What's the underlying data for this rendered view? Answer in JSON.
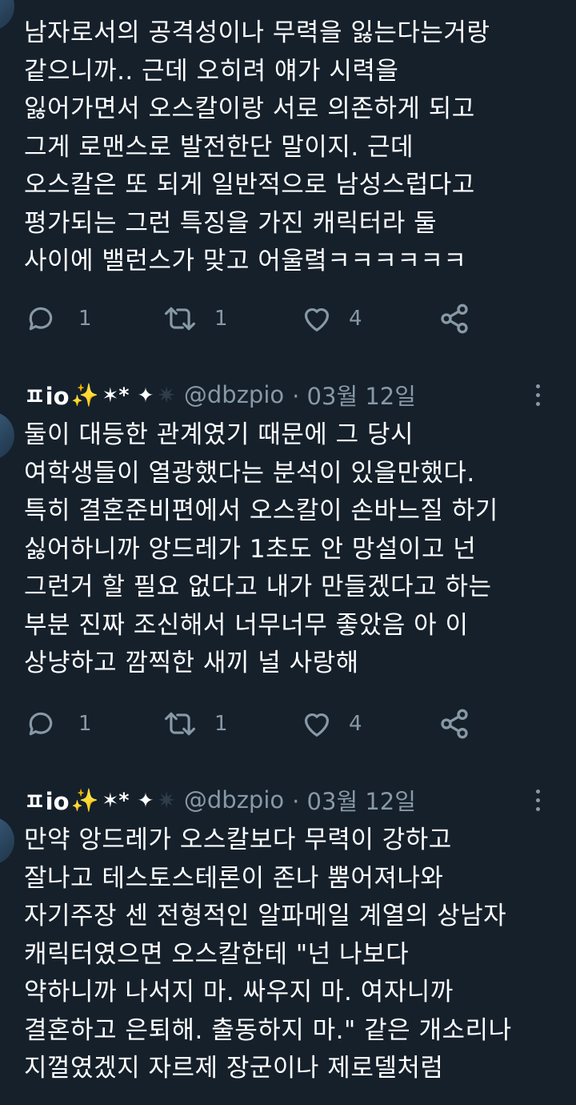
{
  "tweets": [
    {
      "lines": [
        "남자로서의 공격성이나 무력을 잃는다는거랑",
        "같으니까.. 근데 오히려 얘가 시력을",
        "잃어가면서 오스칼이랑 서로 의존하게 되고",
        "그게 로맨스로 발전한단 말이지. 근데",
        "오스칼은 또 되게 일반적으로 남성스럽다고",
        "평가되는 그런 특징을 가진 캐릭터라 둘",
        "사이에 밸런스가 맞고 어울렼ㅋㅋㅋㅋㅋㅋ"
      ],
      "reply_count": "1",
      "retweet_count": "1",
      "like_count": "4"
    },
    {
      "display_name": "ㅍio",
      "handle": "@dbzpio",
      "date": "· 03월 12일",
      "lines": [
        "둘이 대등한 관계였기 때문에 그 당시",
        "여학생들이 열광했다는 분석이 있을만했다.",
        "특히 결혼준비편에서 오스칼이 손바느질 하기",
        "싫어하니까 앙드레가 1초도 안 망설이고 넌",
        "그런거 할 필요 없다고 내가 만들겠다고 하는",
        "부분 진짜 조신해서 너무너무 좋았음 아 이",
        "상냥하고 깜찍한 새끼 널 사랑해"
      ],
      "reply_count": "1",
      "retweet_count": "1",
      "like_count": "4"
    },
    {
      "display_name": "ㅍio",
      "handle": "@dbzpio",
      "date": "· 03월 12일",
      "lines": [
        "만약 앙드레가 오스칼보다 무력이 강하고",
        "잘나고 테스토스테론이 존나 뿜어져나와",
        "자기주장 센 전형적인 알파메일 계열의 상남자",
        "캐릭터였으면 오스칼한테 \"넌 나보다",
        "약하니까 나서지 마. 싸우지 마. 여자니까",
        "결혼하고 은퇴해. 출동하지 마.\" 같은 개소리나",
        "지껄였겠지 자르제 장군이나 제로델처럼"
      ]
    }
  ],
  "name_decoration": {
    "sparkle": "✨",
    "stars": "✶*",
    "four_point_star": "✦",
    "dim_star": "✷"
  },
  "colors": {
    "background": "#15202b",
    "text": "#ffffff",
    "secondary": "#8899a6",
    "sparkle": "#ffcc33"
  },
  "icons": [
    "reply-icon",
    "retweet-icon",
    "like-icon",
    "share-icon",
    "more-icon"
  ]
}
